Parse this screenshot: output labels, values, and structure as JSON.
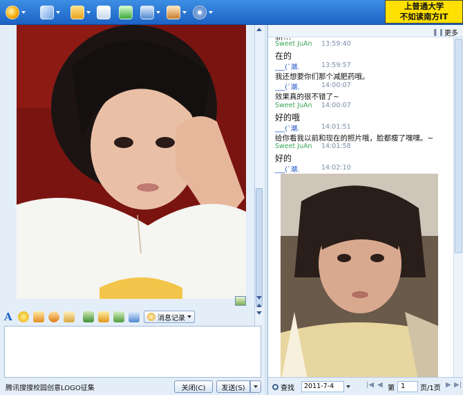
{
  "ad_banner": {
    "line1": "上普通大学",
    "line2": "不如读南方IT"
  },
  "left_panel": {
    "history_button_label": "消息记录",
    "footer_link": "腾讯搜搜校园创意LOGO征集",
    "close_button_label": "关闭(C)",
    "send_button_label": "发送(S)"
  },
  "right_panel": {
    "more_label": "更多",
    "search_label": "查找",
    "date_value": "2011-7-4",
    "page_prefix": "第",
    "page_value": "1",
    "page_suffix": "页/1页",
    "messages": [
      {
        "sender": "Sweet  JuAn",
        "time": "13:59:40",
        "text": "在的",
        "large": true,
        "me": false
      },
      {
        "sender": "___(`潮.",
        "time": "13:59:57",
        "text": "我还想要你们那个减肥药哦。",
        "large": false,
        "me": true
      },
      {
        "sender": "___(`潮.",
        "time": "14:00:07",
        "text": "效果真的很不错了~",
        "large": false,
        "me": true
      },
      {
        "sender": "Sweet  JuAn",
        "time": "14:00:07",
        "text": "好的哦",
        "large": true,
        "me": false
      },
      {
        "sender": "___(`潮.",
        "time": "14:01:51",
        "text": "给你看我以前和现在的照片哦，脸都瘦了嘿嘿。~",
        "large": false,
        "me": true
      },
      {
        "sender": "Sweet  JuAn",
        "time": "14:01:58",
        "text": "好的",
        "large": true,
        "me": false
      },
      {
        "sender": "___(`潮.",
        "time": "14:02:10",
        "text": "",
        "large": false,
        "me": true
      }
    ]
  },
  "colors": {
    "accent": "#1c62c4",
    "green_name": "#3aa657",
    "blue_name": "#1a4fc4",
    "ad_yellow": "#ffe000"
  },
  "icons": [
    "qq-logo-icon",
    "microphone-icon",
    "folder-icon",
    "email-icon",
    "add-icon",
    "network-icon",
    "user-icon",
    "settings-icon"
  ]
}
